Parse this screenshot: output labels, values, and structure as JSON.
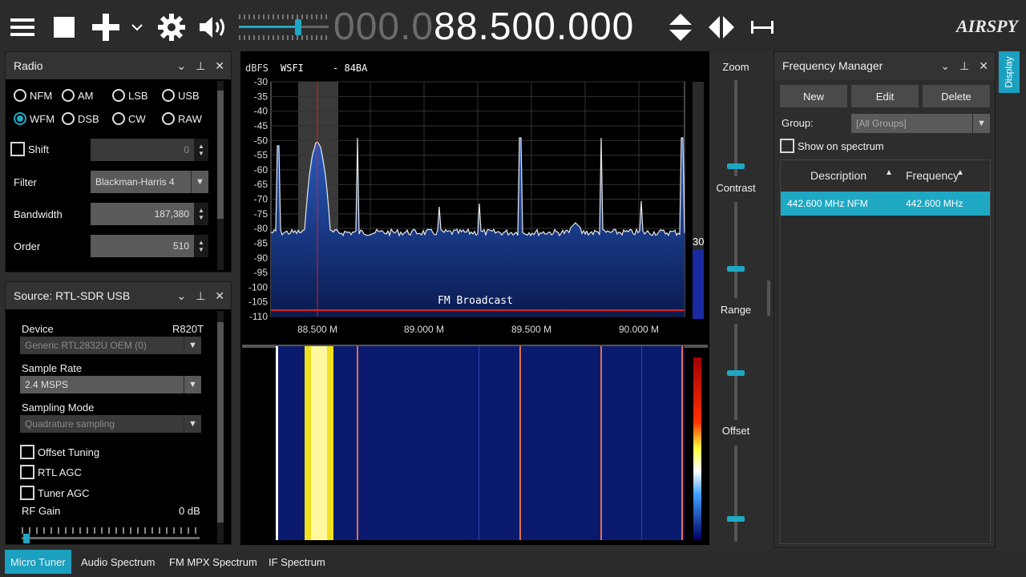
{
  "toolbar": {
    "frequency_dim": "000.0",
    "frequency_main": "88.500.000",
    "brand": "AIRSPY"
  },
  "radio": {
    "title": "Radio",
    "modes": [
      "NFM",
      "AM",
      "LSB",
      "USB",
      "WFM",
      "DSB",
      "CW",
      "RAW"
    ],
    "selected_mode": "WFM",
    "shift_label": "Shift",
    "shift_value": "0",
    "filter_label": "Filter",
    "filter_value": "Blackman-Harris 4",
    "bandwidth_label": "Bandwidth",
    "bandwidth_value": "187,380",
    "order_label": "Order",
    "order_value": "510"
  },
  "source": {
    "title": "Source: RTL-SDR USB",
    "device_label": "Device",
    "device_tuner": "R820T",
    "device_value": "Generic RTL2832U OEM (0)",
    "sample_rate_label": "Sample Rate",
    "sample_rate_value": "2.4 MSPS",
    "sampling_mode_label": "Sampling Mode",
    "sampling_mode_value": "Quadrature sampling",
    "offset_tuning_label": "Offset Tuning",
    "rtl_agc_label": "RTL AGC",
    "tuner_agc_label": "Tuner AGC",
    "rf_gain_label": "RF Gain",
    "rf_gain_value": "0 dB"
  },
  "spectrum": {
    "unit_label": "dBFS",
    "station_label": "WSFI     - 84BA",
    "band_label": "FM Broadcast",
    "level_readout": "30",
    "y_ticks": [
      "-30",
      "-35",
      "-40",
      "-45",
      "-50",
      "-55",
      "-60",
      "-65",
      "-70",
      "-75",
      "-80",
      "-85",
      "-90",
      "-95",
      "-100",
      "-105",
      "-110"
    ],
    "x_ticks": [
      "88.500 M",
      "89.000 M",
      "89.500 M",
      "90.000 M"
    ]
  },
  "side_controls": {
    "zoom_label": "Zoom",
    "contrast_label": "Contrast",
    "range_label": "Range",
    "offset_label": "Offset"
  },
  "freq_manager": {
    "title": "Frequency Manager",
    "new_label": "New",
    "edit_label": "Edit",
    "delete_label": "Delete",
    "group_label": "Group:",
    "group_value": "[All Groups]",
    "show_on_spectrum_label": "Show on spectrum",
    "col_description": "Description",
    "col_frequency": "Frequency",
    "rows": [
      {
        "description": "442.600 MHz NFM",
        "frequency": "442.600 MHz"
      }
    ],
    "side_tab": "Display"
  },
  "bottom_tabs": [
    "Micro Tuner",
    "Audio Spectrum",
    "FM MPX Spectrum",
    "IF Spectrum"
  ],
  "colors": {
    "accent": "#1fa8c4",
    "spectrum_fill": "#1e4a96",
    "marker_red": "#e02020",
    "waterfall_bg": "#0a1a6e"
  }
}
